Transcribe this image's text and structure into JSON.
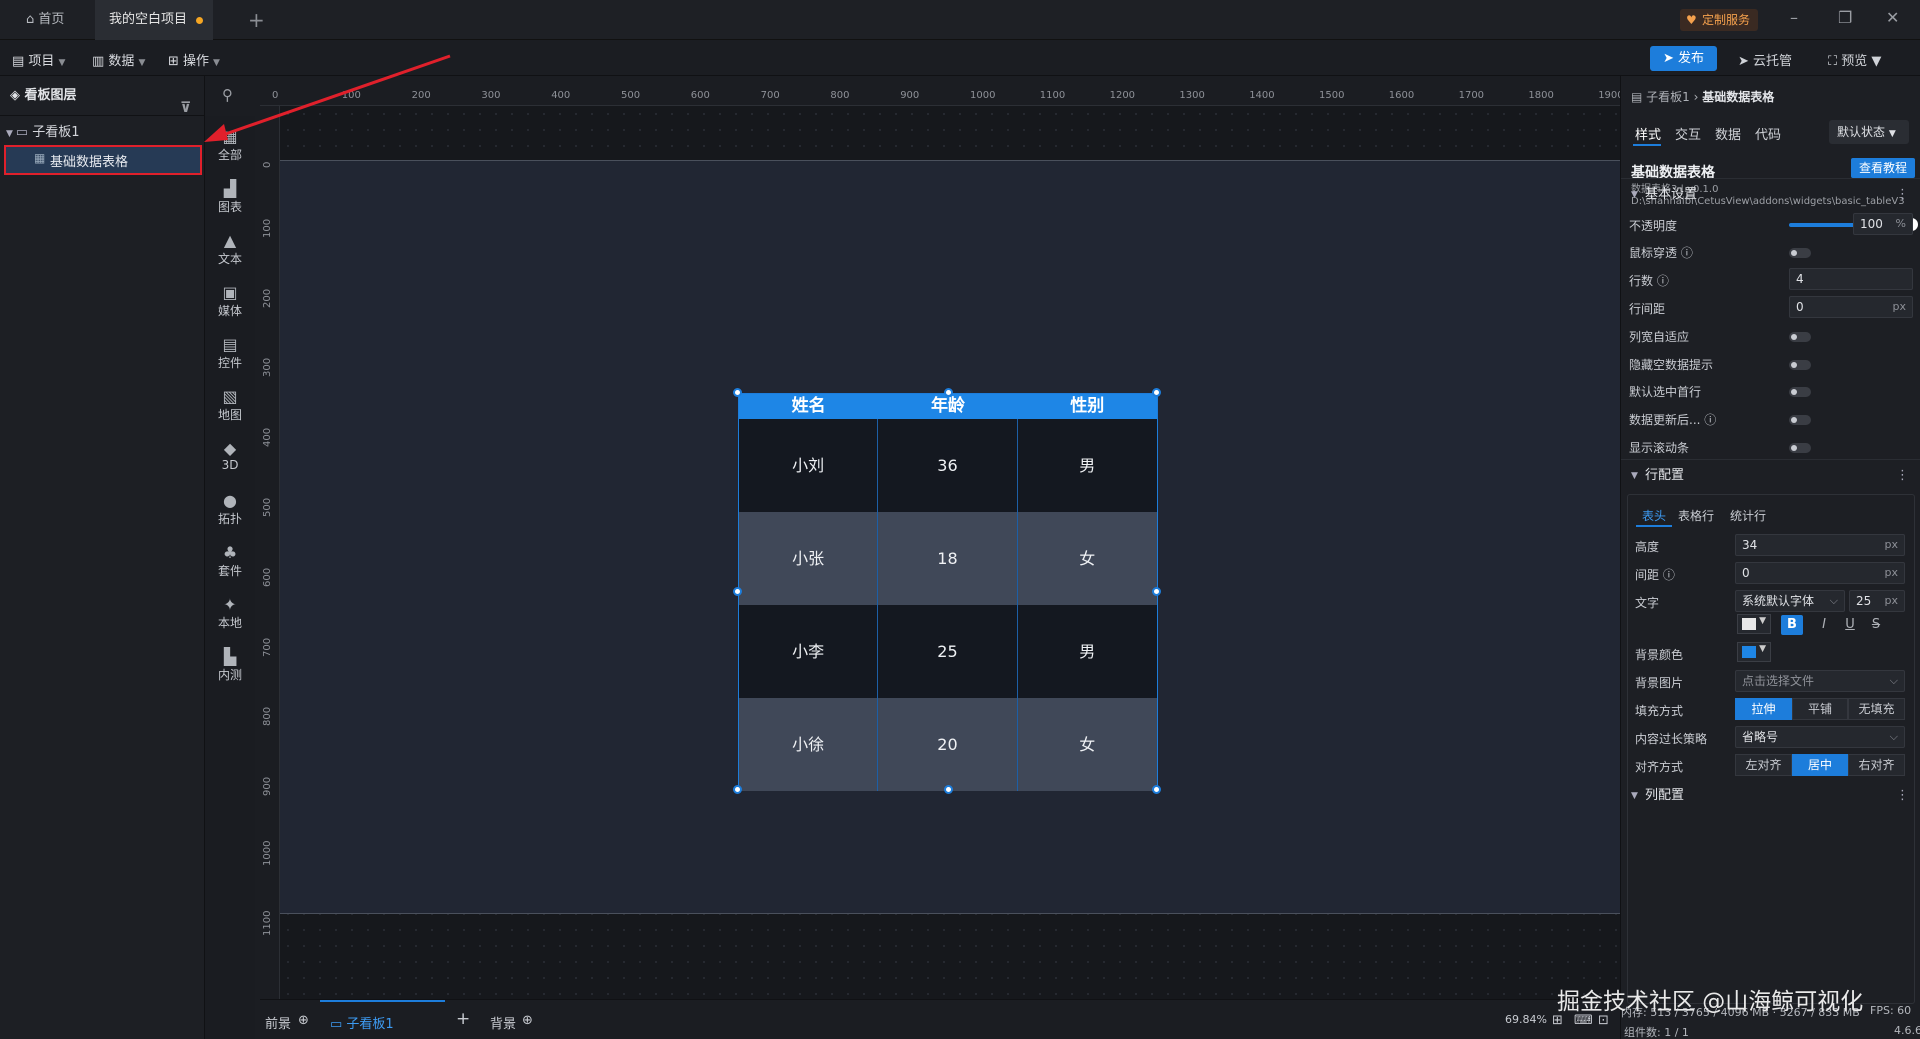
{
  "titlebar": {
    "home_tab": "首页",
    "project_tab": "我的空白项目",
    "custom_service": "定制服务"
  },
  "menubar": {
    "project": "项目",
    "data": "数据",
    "operation": "操作",
    "publish": "发布",
    "cloud_host": "云托管",
    "preview": "预览"
  },
  "layers": {
    "title": "看板图层",
    "board": "子看板1",
    "selected_item": "基础数据表格"
  },
  "components": [
    "全部",
    "图表",
    "文本",
    "媒体",
    "控件",
    "地图",
    "3D",
    "拓扑",
    "套件",
    "本地",
    "内测"
  ],
  "ruler": {
    "h_ticks": [
      "0",
      "100",
      "200",
      "300",
      "400",
      "500",
      "600",
      "700",
      "800",
      "900",
      "1000",
      "1100",
      "1200",
      "1300",
      "1400",
      "1500",
      "1600",
      "1700",
      "1800",
      "1900"
    ],
    "v_ticks": [
      "0",
      "100",
      "200",
      "300",
      "400",
      "500",
      "600",
      "700",
      "800",
      "900",
      "1000",
      "1100"
    ]
  },
  "table": {
    "headers": [
      "姓名",
      "年龄",
      "性别"
    ],
    "rows": [
      [
        "小刘",
        "36",
        "男"
      ],
      [
        "小张",
        "18",
        "女"
      ],
      [
        "小李",
        "25",
        "男"
      ],
      [
        "小徐",
        "20",
        "女"
      ]
    ],
    "header_bg": "#1e86e6"
  },
  "bottombar": {
    "foreground": "前景",
    "board_tab": "子看板1",
    "background": "背景",
    "zoom": "69.84%"
  },
  "rpanel": {
    "breadcrumb_parent": "子看板1",
    "breadcrumb_current": "基础数据表格",
    "tabs": [
      "样式",
      "交互",
      "数据",
      "代码"
    ],
    "state": "默认状态",
    "widget_title": "基础数据表格",
    "widget_sub": "数据表格3 | v0.1.0",
    "widget_path": "D:\\shanhaibi\\CetusView\\addons\\widgets\\basic_tableV3",
    "tutorial": "查看教程",
    "basic_section": "基本设置",
    "opacity_label": "不透明度",
    "opacity_value": "100",
    "opacity_unit": "%",
    "mouse_through": "鼠标穿透",
    "rows_label": "行数",
    "rows_value": "4",
    "row_gap_label": "行间距",
    "row_gap_value": "0",
    "px": "px",
    "col_auto": "列宽自适应",
    "hide_empty": "隐藏空数据提示",
    "select_first": "默认选中首行",
    "data_update": "数据更新后...",
    "show_scroll": "显示滚动条",
    "row_section": "行配置",
    "subtabs": [
      "表头",
      "表格行",
      "统计行"
    ],
    "height_label": "高度",
    "height_value": "34",
    "spacing_label": "间距",
    "spacing_value": "0",
    "text_label": "文字",
    "font_value": "系统默认字体",
    "font_size": "25",
    "bg_color_label": "背景颜色",
    "bg_image_label": "背景图片",
    "bg_image_placeholder": "点击选择文件",
    "fill_label": "填充方式",
    "fill_options": [
      "拉伸",
      "平铺",
      "无填充"
    ],
    "overflow_label": "内容过长策略",
    "overflow_value": "省略号",
    "align_label": "对齐方式",
    "align_options": [
      "左对齐",
      "居中",
      "右对齐"
    ],
    "col_section": "列配置"
  },
  "watermark": "掘金技术社区 @山海鲸可视化",
  "status": {
    "memory": "内存: 513 / 3765 / 4096 MB · 5267 / 833 MB",
    "fps": "FPS: 60",
    "count": "组件数: 1 / 1",
    "version": "4.6.6"
  }
}
